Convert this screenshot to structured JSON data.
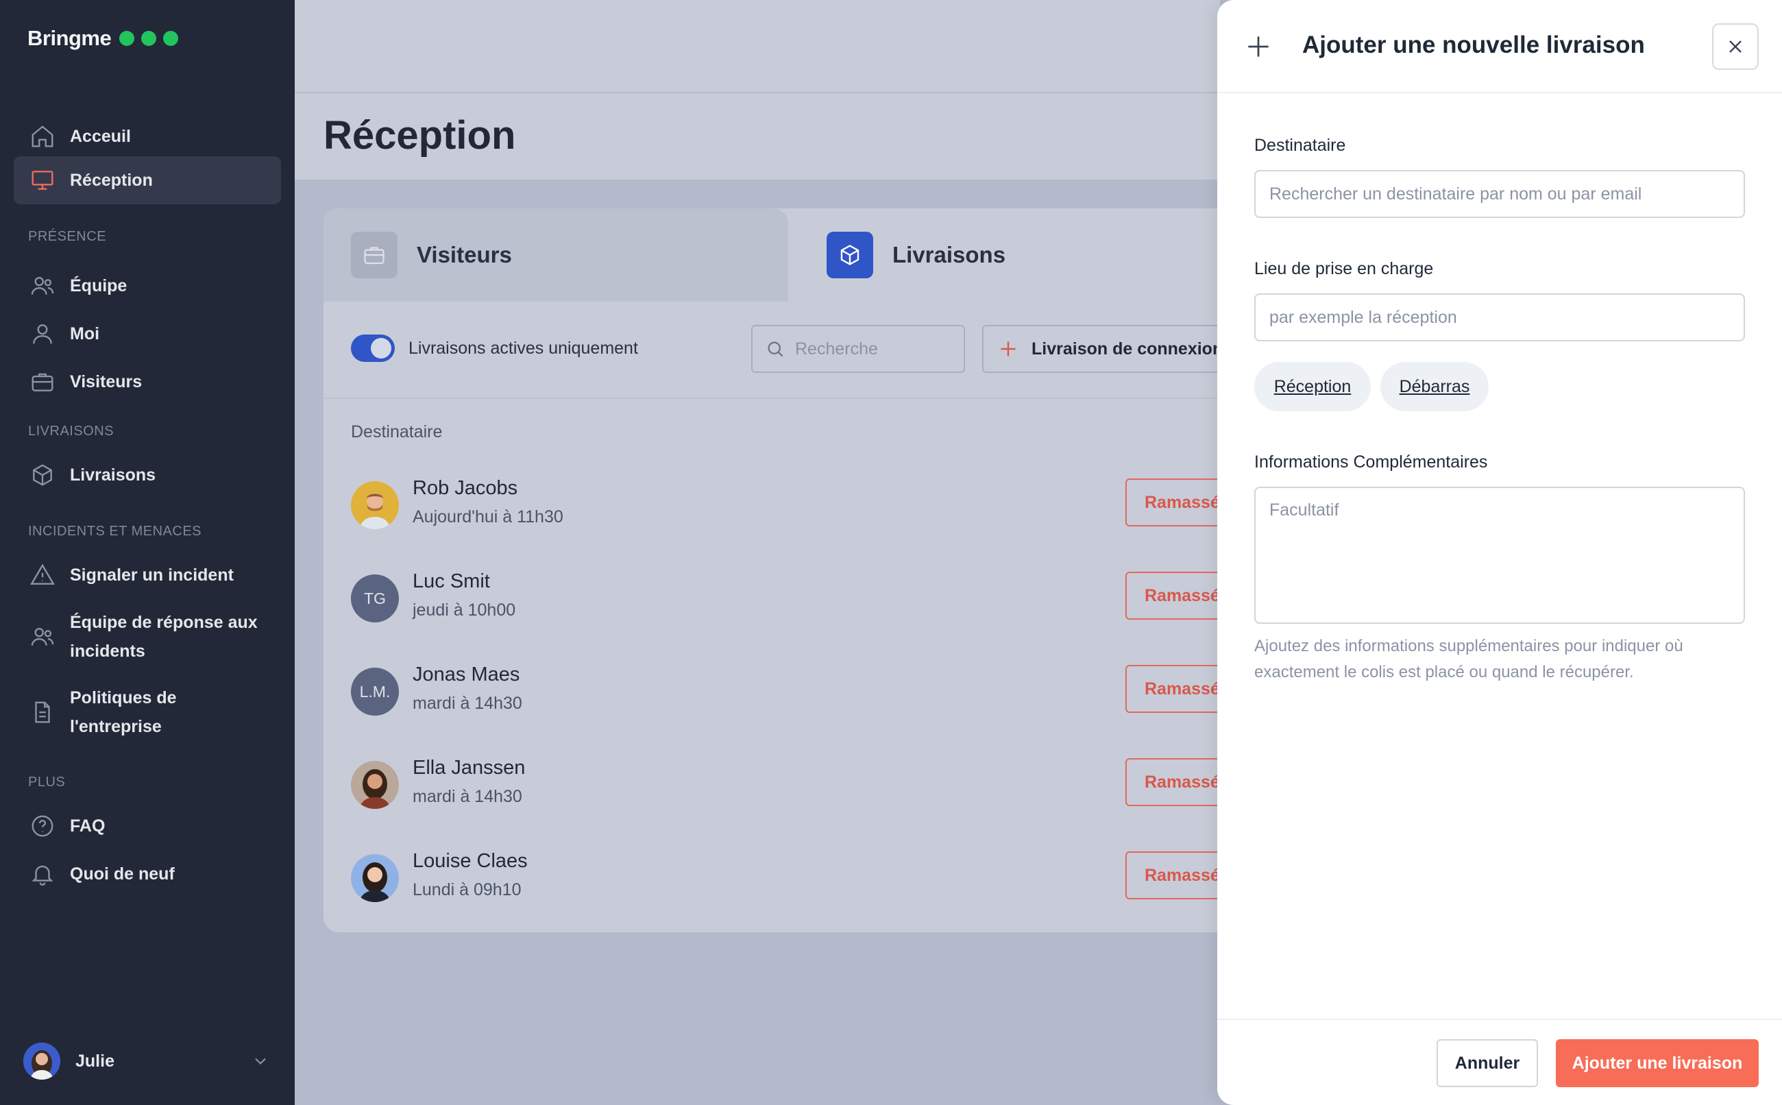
{
  "brand": {
    "name": "Bringme",
    "dot_color": "#21c45d"
  },
  "sidebar": {
    "items": [
      {
        "label": "Acceuil",
        "icon": "home-icon"
      },
      {
        "label": "Réception",
        "icon": "monitor-icon",
        "active": true
      },
      {
        "label": "Équipe",
        "icon": "users-icon"
      },
      {
        "label": "Moi",
        "icon": "user-icon"
      },
      {
        "label": "Visiteurs",
        "icon": "briefcase-icon"
      },
      {
        "label": "Livraisons",
        "icon": "package-icon"
      },
      {
        "label": "Signaler un incident",
        "icon": "warning-icon"
      },
      {
        "label": "Équipe de réponse aux",
        "label2": "incidents",
        "icon": "users-icon"
      },
      {
        "label": "Politiques de",
        "label2": "l'entreprise",
        "icon": "document-icon"
      },
      {
        "label": "FAQ",
        "icon": "help-circle-icon"
      },
      {
        "label": "Quoi de neuf",
        "icon": "bell-icon"
      }
    ],
    "sections": {
      "presence": "PRÉSENCE",
      "deliveries": "LIVRAISONS",
      "incidents": "INCIDENTS ET MENACES",
      "more": "PLUS"
    },
    "user": {
      "name": "Julie"
    }
  },
  "main": {
    "title": "Réception",
    "tabs": [
      {
        "label": "Visiteurs",
        "icon": "briefcase-icon"
      },
      {
        "label": "Livraisons",
        "icon": "package-icon"
      }
    ],
    "toolbar": {
      "toggle_label": "Livraisons actives uniquement",
      "toggle_on": true,
      "search_placeholder": "Recherche",
      "add_label": "Livraison de connexion"
    },
    "table": {
      "column": "Destinataire",
      "action_label": "Ramassé",
      "rows": [
        {
          "name": "Rob Jacobs",
          "time": "Aujourd'hui à 11h30",
          "avatar": "photo"
        },
        {
          "name": "Luc Smit",
          "time": "jeudi à 10h00",
          "initials": "TG"
        },
        {
          "name": "Jonas Maes",
          "time": "mardi à 14h30",
          "initials": "L.M."
        },
        {
          "name": "Ella Janssen",
          "time": "mardi à 14h30",
          "avatar": "photo"
        },
        {
          "name": "Louise Claes",
          "time": "Lundi à 09h10",
          "avatar": "photo"
        }
      ]
    }
  },
  "drawer": {
    "title": "Ajouter une nouvelle livraison",
    "recipient_label": "Destinataire",
    "recipient_placeholder": "Rechercher un destinataire par nom ou par email",
    "location_label": "Lieu de prise en charge",
    "location_placeholder": "par exemple la réception",
    "chips": [
      "Réception",
      "Débarras"
    ],
    "info_label": "Informations Complémentaires",
    "info_placeholder": "Facultatif",
    "help_text": "Ajoutez des informations supplémentaires pour indiquer où exactement le colis est placé ou quand le récupérer.",
    "cancel_label": "Annuler",
    "submit_label": "Ajouter une livraison",
    "accent_color": "#f76d58"
  }
}
